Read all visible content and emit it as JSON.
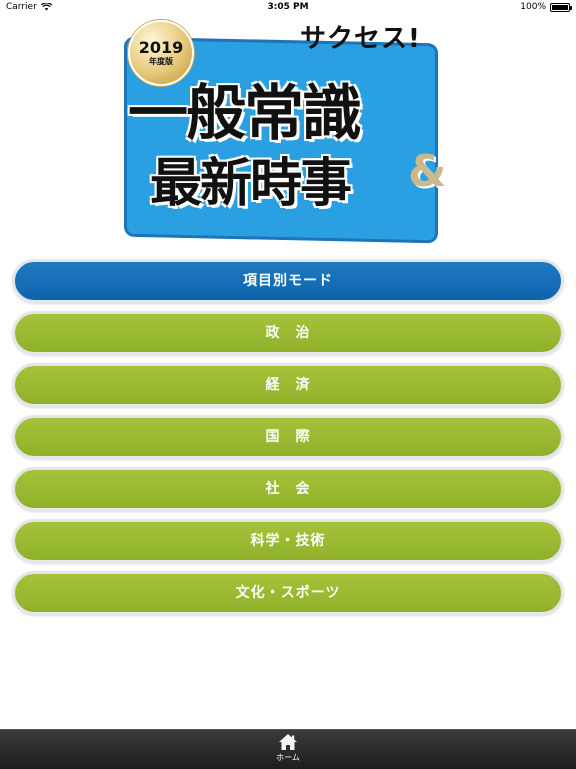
{
  "status_bar": {
    "carrier": "Carrier",
    "time": "3:05 PM",
    "battery": "100%",
    "battery_level": 1.0
  },
  "logo": {
    "brand": "サクセス!",
    "badge_year": "2019",
    "badge_sub": "年度版",
    "title_line1": "一般常識",
    "title_line2": "最新時事",
    "ampersand": "&"
  },
  "menu": {
    "header_label": "項目別モード",
    "items": [
      {
        "label": "政　治"
      },
      {
        "label": "経　済"
      },
      {
        "label": "国　際"
      },
      {
        "label": "社　会"
      },
      {
        "label": "科学・技術"
      },
      {
        "label": "文化・スポーツ"
      }
    ]
  },
  "tab_bar": {
    "home_label": "ホーム",
    "home_icon": "home-icon"
  },
  "colors": {
    "header_button": "#1a74ba",
    "category_button": "#9abb33",
    "logo_blue": "#2aa0e3",
    "tab_bar": "#2a2a2a"
  }
}
